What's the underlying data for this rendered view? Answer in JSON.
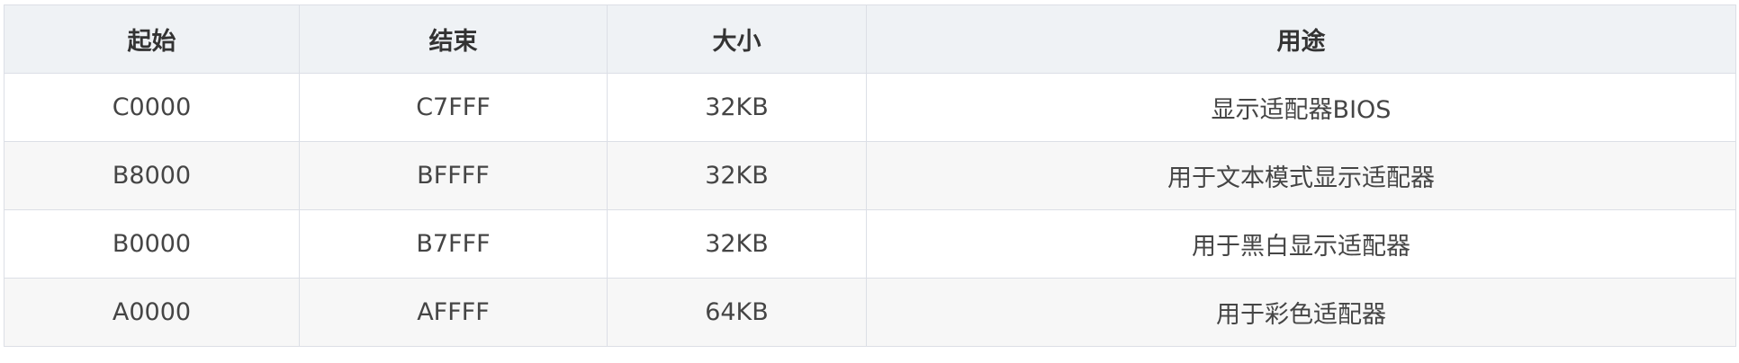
{
  "table": {
    "headers": [
      "起始",
      "结束",
      "大小",
      "用途"
    ],
    "rows": [
      [
        "C0000",
        "C7FFF",
        "32KB",
        "显示适配器BIOS"
      ],
      [
        "B8000",
        "BFFFF",
        "32KB",
        "用于文本模式显示适配器"
      ],
      [
        "B0000",
        "B7FFF",
        "32KB",
        "用于黑白显示适配器"
      ],
      [
        "A0000",
        "AFFFF",
        "64KB",
        "用于彩色适配器"
      ]
    ]
  }
}
